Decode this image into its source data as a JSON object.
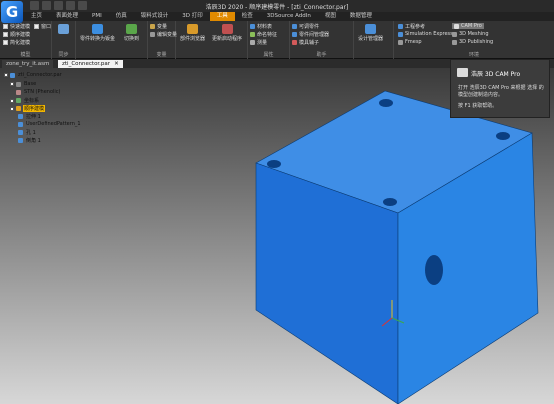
{
  "window": {
    "title": "浩辰3D 2020 - 顺序建模零件 - [zti_Connector.par]"
  },
  "app": {
    "logo_glyph": "G"
  },
  "ribbon_tabs": [
    "主页",
    "表面处理",
    "PMI",
    "仿真",
    "钣料式设计",
    "3D 打印",
    "检查",
    "3DSource AddIn",
    "视图",
    "数据管理"
  ],
  "ribbon_active_tab": "工具",
  "ribbon": {
    "model_group": {
      "label": "模型",
      "options": [
        "快速建模",
        "顺序建模",
        "简化建模"
      ],
      "extra": "窗口"
    },
    "view_group": {
      "label": "同步",
      "items": [
        "零件转换为钣金",
        "切换到"
      ]
    },
    "assist_group": {
      "label": "变量",
      "items": [
        "变量",
        "编辑变量"
      ]
    },
    "editor_group": {
      "label": "助手",
      "items": [
        "部件浏览器",
        "更新启动程序"
      ]
    },
    "properties_group": {
      "label": "属性",
      "items": [
        "材料表",
        "零件间管理器",
        "命名特征",
        "测量"
      ]
    },
    "helper_group": {
      "label": "助手",
      "items": [
        "可调零件",
        "零件间管理器",
        "模具辅子"
      ]
    },
    "design_group": {
      "label": "设计管理器",
      "items": [
        "设计管理器"
      ]
    },
    "env_group": {
      "label": "环境",
      "items": [
        "工程参考",
        "Simulation Express",
        "Fmesp"
      ],
      "items2": [
        "CAM Pro",
        "3D Meshing",
        "3D Publishing"
      ]
    }
  },
  "doc_tabs": [
    {
      "label": "zone_try_it.asm",
      "active": false
    },
    {
      "label": "zti_Connector.par",
      "active": true
    }
  ],
  "tree": {
    "items": [
      {
        "label": "zti_Connector.par",
        "indent": 0
      },
      {
        "label": "Base",
        "indent": 1
      },
      {
        "label": "STN (Phenolic)",
        "indent": 2
      },
      {
        "label": "坐标系",
        "indent": 1
      },
      {
        "label": "顺序建模",
        "indent": 1,
        "selected": true
      },
      {
        "label": "拉伸 1",
        "indent": 2
      },
      {
        "label": "UserDefinedPattern_1",
        "indent": 2
      },
      {
        "label": "孔 1",
        "indent": 2
      },
      {
        "label": "倒角 1",
        "indent": 2
      }
    ]
  },
  "tooltip": {
    "title": "浩辰 3D CAM Pro",
    "description": "打开 浩辰3D CAM Pro 来根据 选择 的 模型创建制造内容。",
    "help": "按 F1 获取帮助。"
  },
  "colors": {
    "accent": "#e08a00",
    "cube_top": "#3f8ee6",
    "cube_left": "#1f6fd6",
    "cube_right": "#2a85e4",
    "selected_highlight": "#f2b600"
  }
}
